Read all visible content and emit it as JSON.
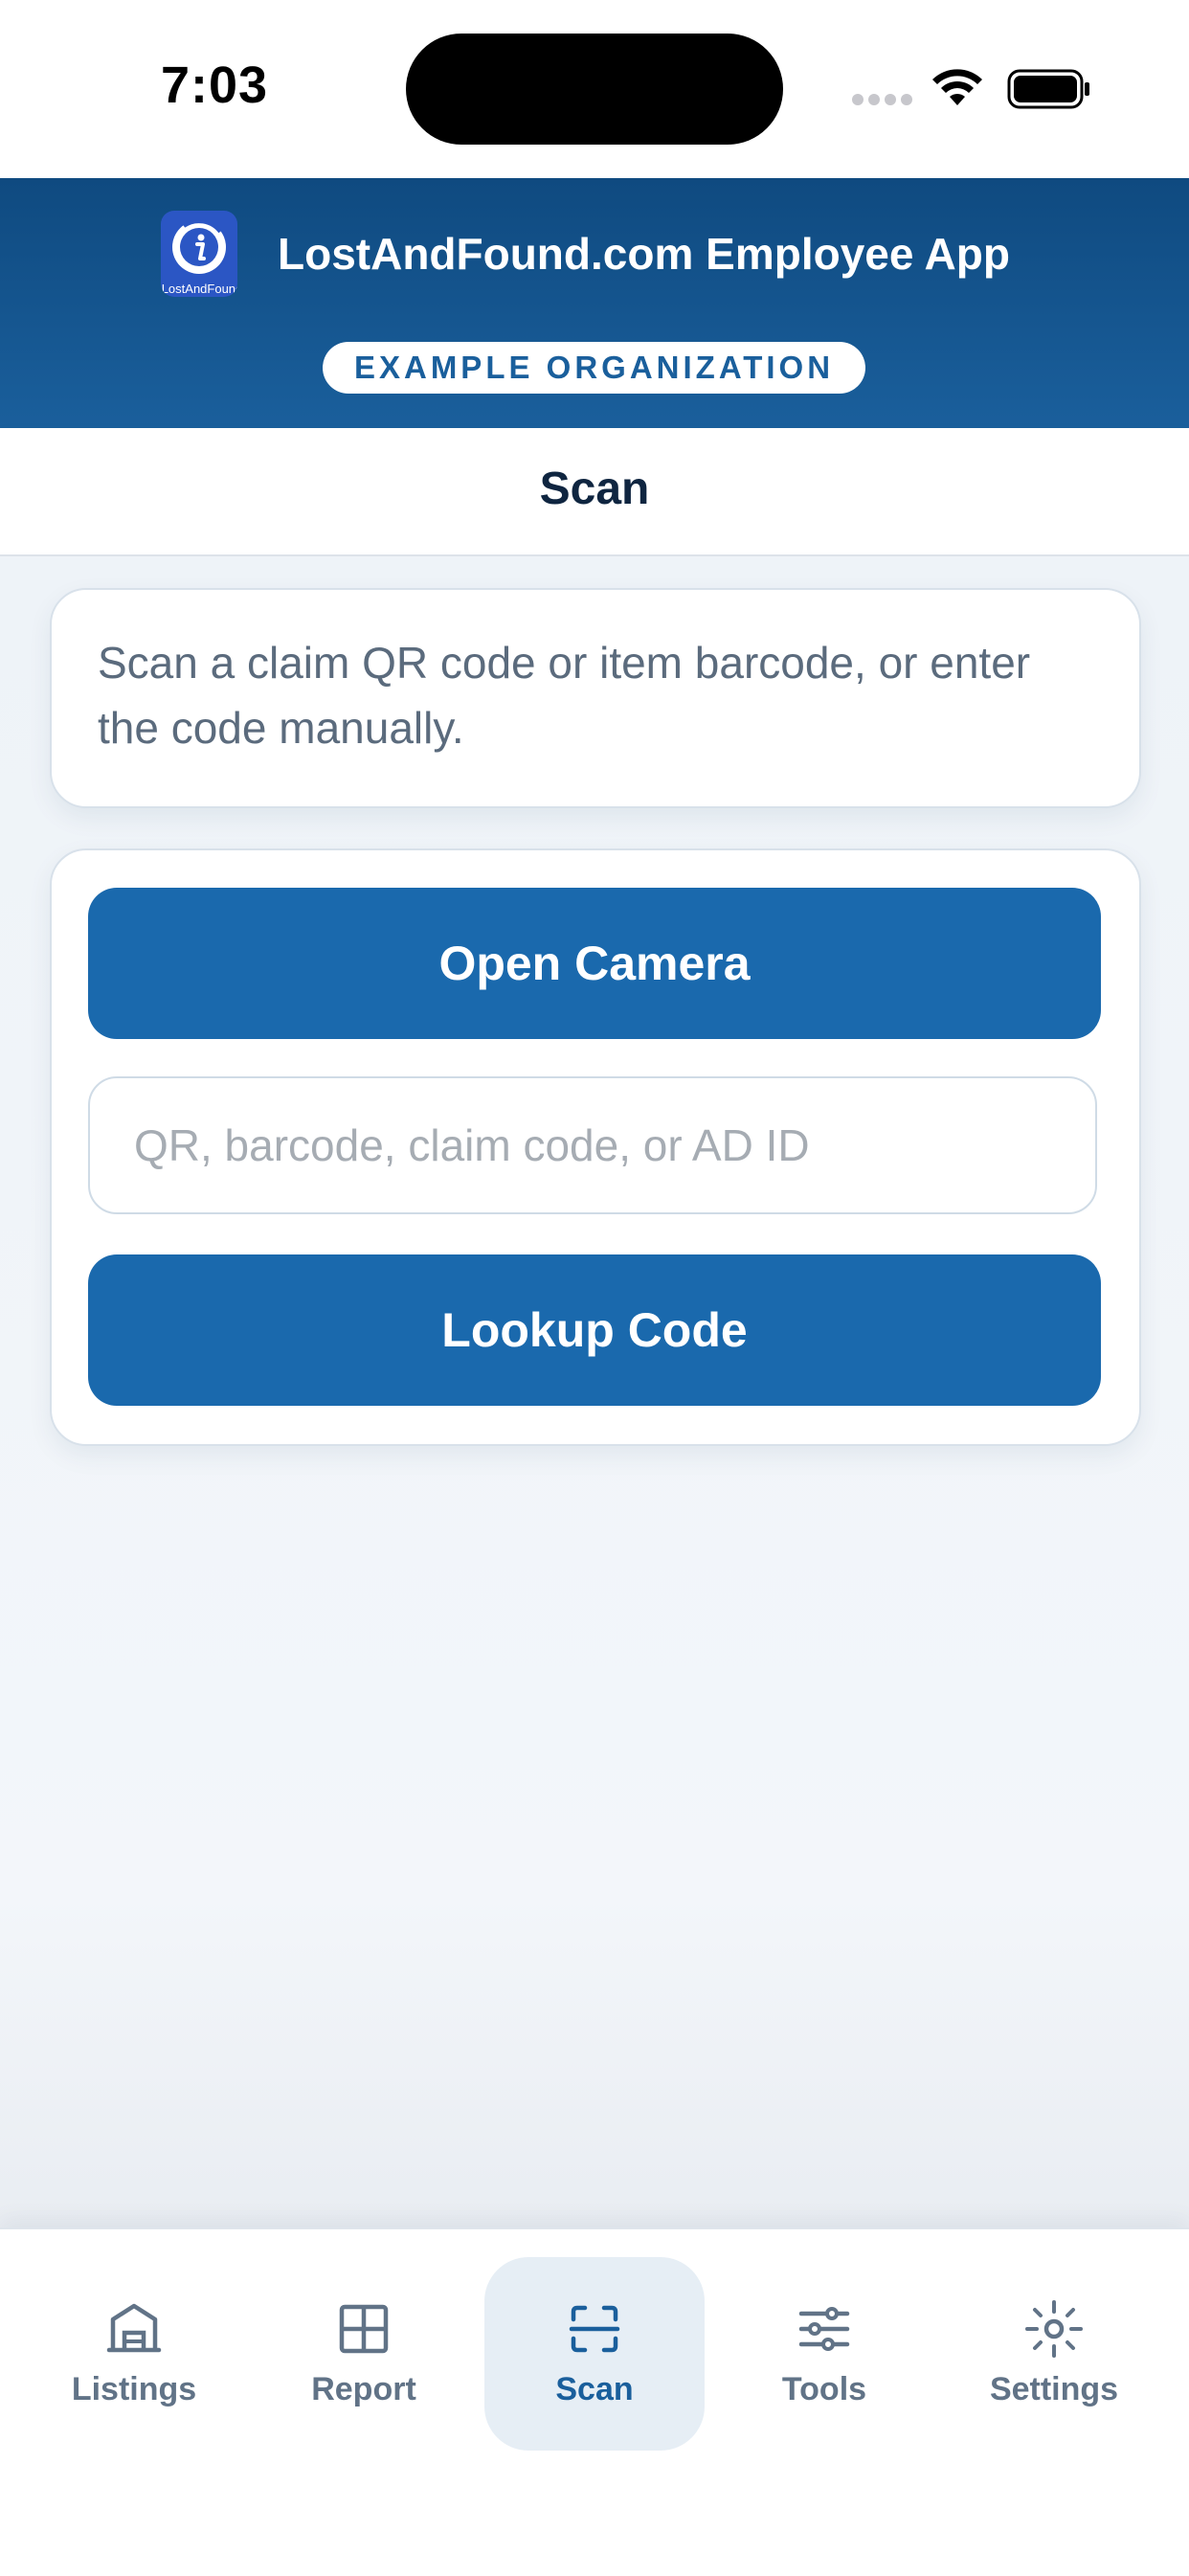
{
  "status_bar": {
    "time": "7:03"
  },
  "header": {
    "logo_text": "LostAndFound",
    "app_title": "LostAndFound.com Employee App",
    "organization": "EXAMPLE ORGANIZATION"
  },
  "page": {
    "title": "Scan"
  },
  "info": {
    "text": "Scan a claim QR code or item barcode, or enter the code manually."
  },
  "actions": {
    "open_camera_label": "Open Camera",
    "code_placeholder": "QR, barcode, claim code, or AD ID",
    "code_value": "",
    "lookup_label": "Lookup Code"
  },
  "tabs": [
    {
      "label": "Listings",
      "icon": "building-icon",
      "active": false
    },
    {
      "label": "Report",
      "icon": "grid-icon",
      "active": false
    },
    {
      "label": "Scan",
      "icon": "scan-icon",
      "active": true
    },
    {
      "label": "Tools",
      "icon": "sliders-icon",
      "active": false
    },
    {
      "label": "Settings",
      "icon": "sun-gear-icon",
      "active": false
    }
  ],
  "colors": {
    "primary": "#1a69ad",
    "header_dark": "#0f4a80",
    "text_muted": "#617387"
  }
}
